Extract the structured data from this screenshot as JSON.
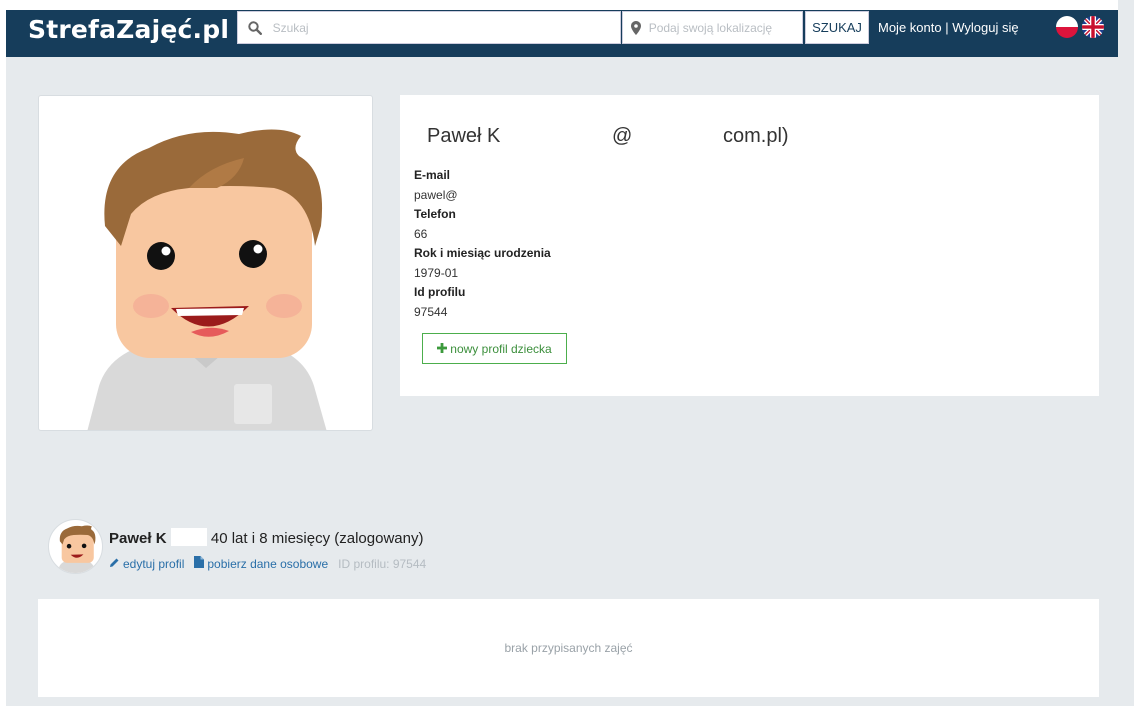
{
  "header": {
    "brand": "StrefaZajęć.pl",
    "search_placeholder": "Szukaj",
    "location_placeholder": "Podaj swoją lokalizację",
    "search_button": "SZUKAJ",
    "my_account": "Moje konto",
    "separator": "|",
    "logout": "Wyloguj się",
    "colors": {
      "bar": "#163d5b"
    }
  },
  "profile": {
    "name": "Paweł K",
    "email_at": "@",
    "email_domain_tail": "com.pl)",
    "fields": [
      {
        "label": "E-mail",
        "value": "pawel@"
      },
      {
        "label": "Telefon",
        "value": "66"
      },
      {
        "label": "Rok i miesiąc urodzenia",
        "value": "1979-01"
      },
      {
        "label": "Id profilu",
        "value": "97544"
      }
    ],
    "new_child_button": "nowy profil dziecka"
  },
  "child": {
    "name": "Paweł K",
    "age": "40 lat i 8 miesięcy (zalogowany)",
    "edit_link": "edytuj profil",
    "download_link": "pobierz dane osobowe",
    "profile_id": "ID profilu: 97544"
  },
  "classes": {
    "empty_text": "brak przypisanych zajęć"
  }
}
